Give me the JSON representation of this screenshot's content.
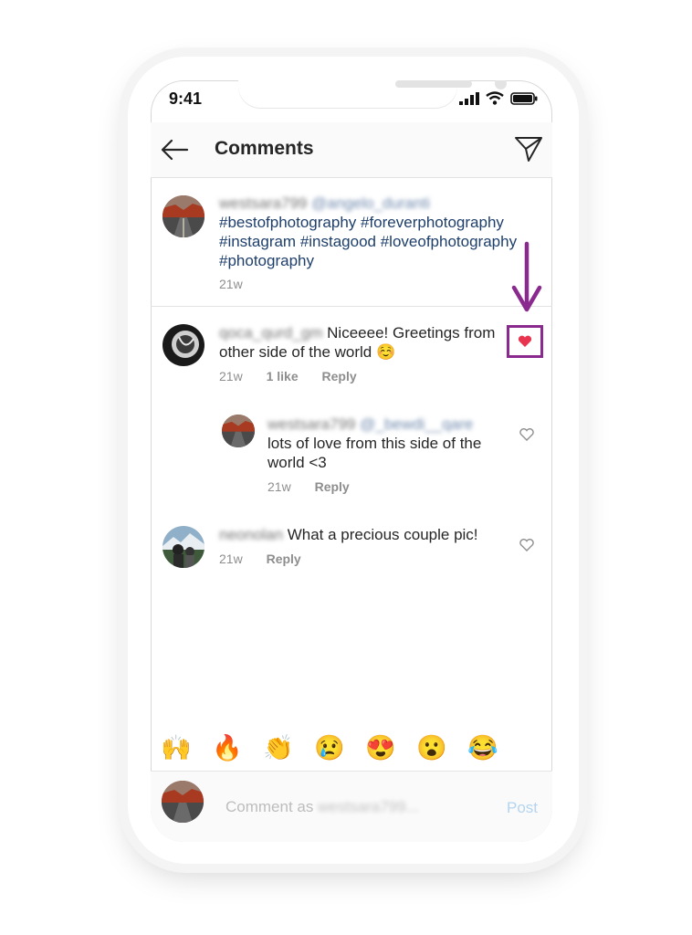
{
  "status_bar": {
    "time": "9:41"
  },
  "header": {
    "title": "Comments"
  },
  "caption": {
    "username": "westsara799",
    "mention": "@angelo_duranti",
    "hashtags": "#bestofphotography #foreverphotography #instagram #instagood #loveofphotography #photography",
    "time": "21w"
  },
  "comments": [
    {
      "username": "qoca_qurd_gm",
      "text": "Niceeee! Greetings from other side of the world",
      "emoji": "☺️",
      "time": "21w",
      "likes": "1 like",
      "reply_label": "Reply",
      "liked": true
    },
    {
      "username": "westsara799",
      "mention": "@_bewdi__qare",
      "text": "lots of love from this side of the world <3",
      "time": "21w",
      "reply_label": "Reply",
      "liked": false
    },
    {
      "username": "neonolan",
      "text": "What a precious couple pic!",
      "time": "21w",
      "reply_label": "Reply",
      "liked": false
    }
  ],
  "emoji_bar": [
    "🙌",
    "🔥",
    "👏",
    "😢",
    "😍",
    "😮",
    "😂"
  ],
  "composer": {
    "placeholder_prefix": "Comment as",
    "placeholder_user": "westsara799...",
    "post_label": "Post"
  },
  "colors": {
    "annotation": "#8a2a8f",
    "heart": "#e8344e",
    "link": "#1e3f6b",
    "post": "#b4d4ef"
  },
  "icons": [
    "back-arrow-icon",
    "send-icon",
    "heart-icon",
    "signal-icon",
    "wifi-icon",
    "battery-icon"
  ]
}
